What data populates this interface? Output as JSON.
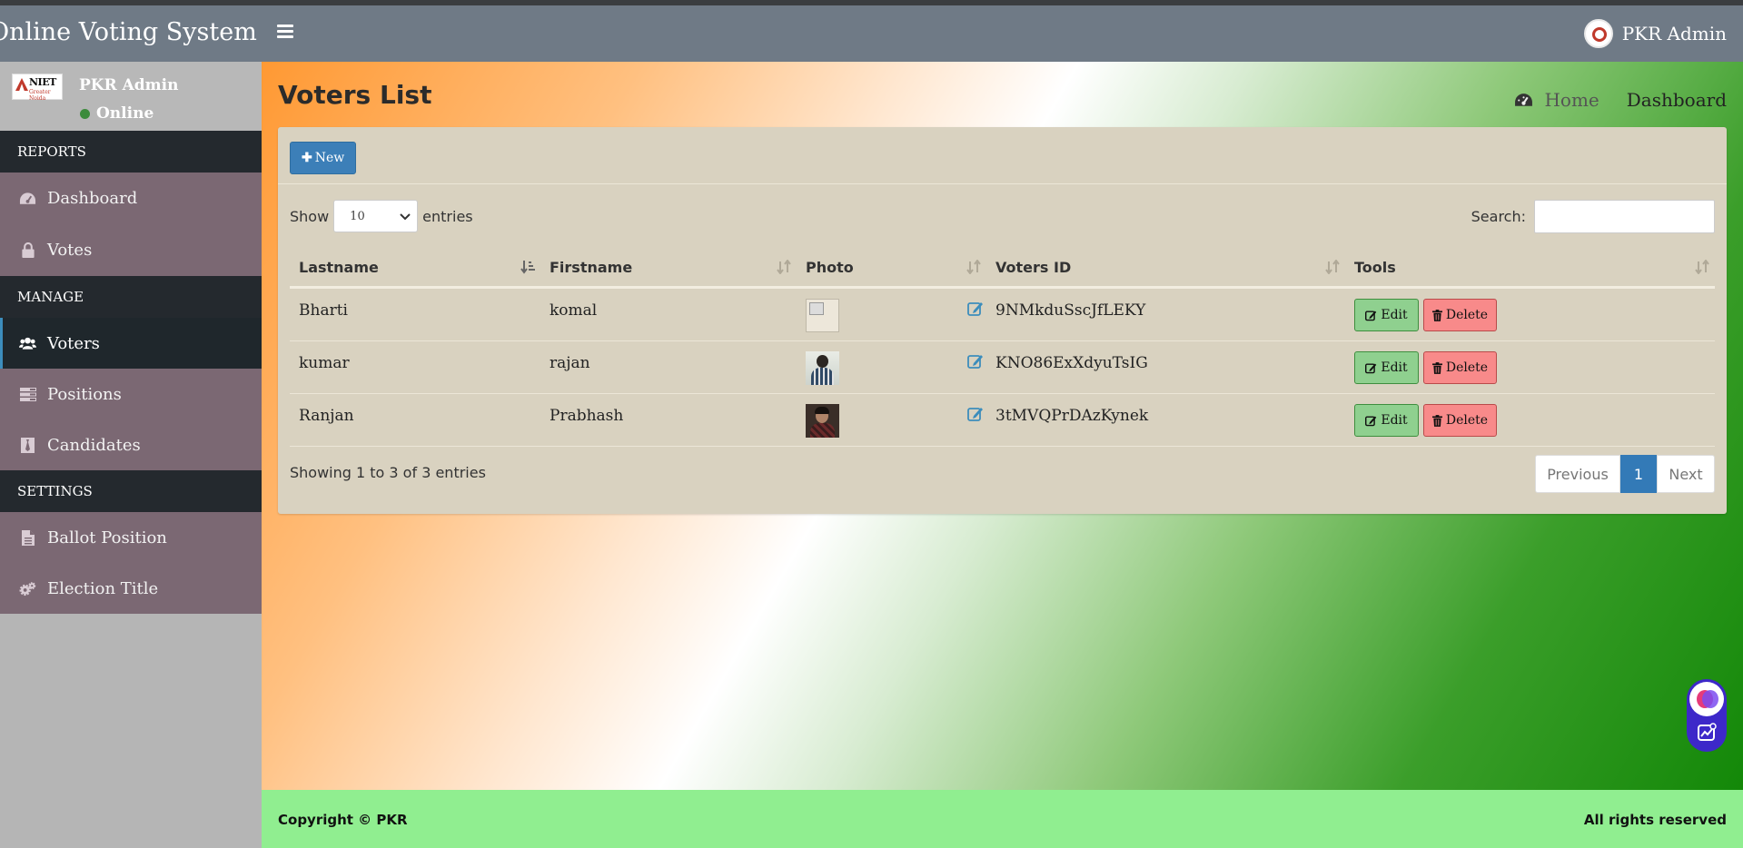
{
  "header": {
    "brand": "Online Voting System",
    "user_name": "PKR Admin"
  },
  "sidebar": {
    "user_panel": {
      "name": "PKR Admin",
      "status": "Online",
      "logo_text": "NIET",
      "logo_sub": "Greater Noida"
    },
    "sections": [
      {
        "header": "REPORTS",
        "items": [
          {
            "label": "Dashboard",
            "icon": "dashboard-icon"
          },
          {
            "label": "Votes",
            "icon": "lock-icon"
          }
        ]
      },
      {
        "header": "MANAGE",
        "items": [
          {
            "label": "Voters",
            "icon": "users-icon",
            "active": true
          },
          {
            "label": "Positions",
            "icon": "tasks-icon"
          },
          {
            "label": "Candidates",
            "icon": "black-tie-icon"
          }
        ]
      },
      {
        "header": "SETTINGS",
        "items": [
          {
            "label": "Ballot Position",
            "icon": "file-icon"
          },
          {
            "label": "Election Title",
            "icon": "cogs-icon"
          }
        ]
      }
    ]
  },
  "page": {
    "title": "Voters List",
    "breadcrumb": {
      "home": "Home",
      "current": "Dashboard"
    }
  },
  "toolbar": {
    "new_label": "New"
  },
  "table_controls": {
    "show_label": "Show",
    "entries_value": "10",
    "entries_label": "entries",
    "search_label": "Search:",
    "search_value": ""
  },
  "table": {
    "columns": [
      "Lastname",
      "Firstname",
      "Photo",
      "Voters ID",
      "Tools"
    ],
    "rows": [
      {
        "lastname": "Bharti",
        "firstname": "komal",
        "photo": "broken-image",
        "voters_id": "9NMkduSscJfLEKY"
      },
      {
        "lastname": "kumar",
        "firstname": "rajan",
        "photo": "person-photo",
        "voters_id": "KNO86ExXdyuTsIG"
      },
      {
        "lastname": "Ranjan",
        "firstname": "Prabhash",
        "photo": "person-photo",
        "voters_id": "3tMVQPrDAzKynek"
      }
    ],
    "edit_label": "Edit",
    "delete_label": "Delete"
  },
  "pagination": {
    "info": "Showing 1 to 3 of 3 entries",
    "previous": "Previous",
    "current_page": "1",
    "next": "Next"
  },
  "footer": {
    "copyright": "Copyright © PKR",
    "rights": "All rights reserved"
  },
  "colors": {
    "header_bg": "#6f7a86",
    "sidebar_bg": "#b5b5b5",
    "nav_group_bg": "#7b6873",
    "nav_header_bg": "#24292e",
    "box_bg": "#d9d2c0",
    "primary": "#3c7fb8",
    "edit_button": "#8fd08f",
    "delete_button": "#f88a8a",
    "footer_bg": "#90ee90",
    "gradient_saffron": "#ff9933",
    "gradient_green": "#138808"
  }
}
